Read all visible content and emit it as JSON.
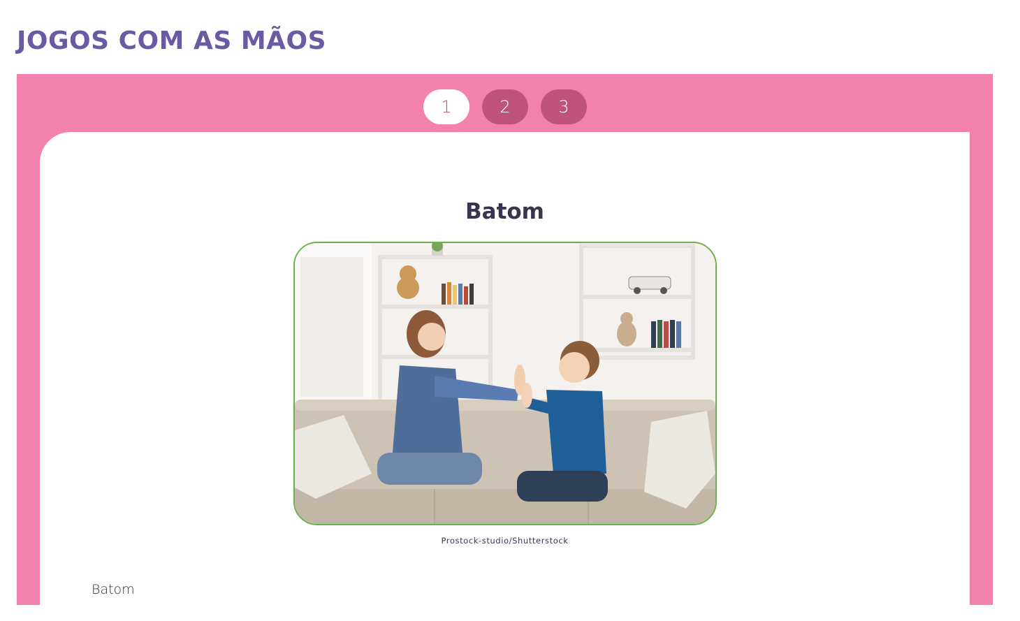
{
  "page": {
    "title": "JOGOS COM AS MÃOS"
  },
  "tabs": [
    {
      "label": "1",
      "active": true
    },
    {
      "label": "2",
      "active": false
    },
    {
      "label": "3",
      "active": false
    }
  ],
  "slide": {
    "title": "Batom",
    "image_credit": "Prostock-studio/Shutterstock",
    "body_text": "Batom"
  },
  "colors": {
    "title": "#6b5aa3",
    "panel": "#f481ad",
    "tab_inactive": "#c0527e",
    "tab_active": "#ffffff",
    "image_border": "#6bb24a",
    "heading": "#3a3450"
  }
}
